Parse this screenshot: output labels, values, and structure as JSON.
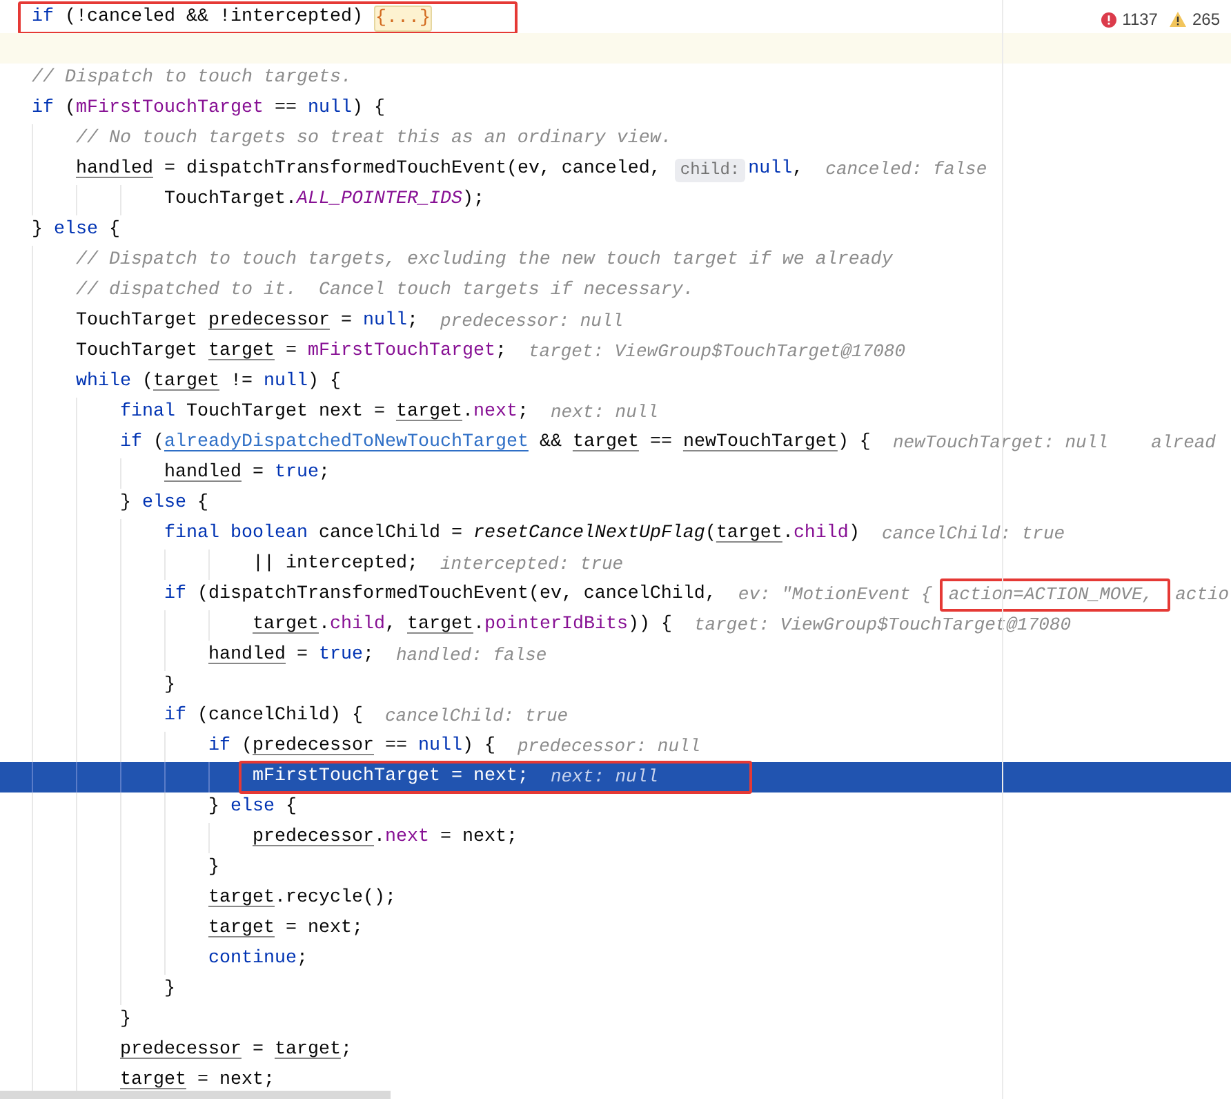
{
  "inspections": {
    "errors": "1137",
    "warnings": "265"
  },
  "lines": [
    {
      "caret_line": false,
      "execution_point": false,
      "segments": [
        {
          "kind": "box",
          "segments": [
            {
              "kind": "keyword",
              "text": "if"
            },
            {
              "kind": "plain",
              "text": " (!canceled && !intercepted) "
            },
            {
              "kind": "fold",
              "text": "{...}"
            }
          ]
        }
      ]
    },
    {
      "caret_line": true,
      "execution_point": false
    },
    {
      "caret_line": false,
      "execution_point": false,
      "segments": [
        {
          "kind": "comment",
          "text": "// Dispatch to touch targets."
        }
      ]
    },
    {
      "caret_line": false,
      "execution_point": false,
      "segments": [
        {
          "kind": "keyword",
          "text": "if"
        },
        {
          "kind": "plain",
          "text": " ("
        },
        {
          "kind": "field",
          "text": "mFirstTouchTarget"
        },
        {
          "kind": "plain",
          "text": " == "
        },
        {
          "kind": "keyword",
          "text": "null"
        },
        {
          "kind": "plain",
          "text": ") {"
        }
      ]
    },
    {
      "caret_line": false,
      "execution_point": false,
      "segments": [
        {
          "kind": "comment",
          "text": "    // No touch targets so treat this as an ordinary view."
        }
      ]
    },
    {
      "caret_line": false,
      "execution_point": false,
      "segments": [
        {
          "kind": "variable",
          "text": "    handled"
        },
        {
          "kind": "plain",
          "text": " = dispatchTransformedTouchEvent(ev, canceled, "
        },
        {
          "kind": "param",
          "text": "child:"
        },
        {
          "kind": "keyword",
          "text": "null"
        },
        {
          "kind": "plain",
          "text": ",  "
        },
        {
          "kind": "hint",
          "text": "canceled: false"
        }
      ]
    },
    {
      "caret_line": false,
      "execution_point": false,
      "segments": [
        {
          "kind": "plain",
          "text": "            TouchTarget."
        },
        {
          "kind": "static",
          "text": "ALL_POINTER_IDS"
        },
        {
          "kind": "plain",
          "text": ");"
        }
      ]
    },
    {
      "caret_line": false,
      "execution_point": false,
      "segments": [
        {
          "kind": "plain",
          "text": "} "
        },
        {
          "kind": "keyword",
          "text": "else"
        },
        {
          "kind": "plain",
          "text": " {"
        }
      ]
    },
    {
      "caret_line": false,
      "execution_point": false,
      "segments": [
        {
          "kind": "comment",
          "text": "    // Dispatch to touch targets, excluding the new touch target if we already"
        }
      ]
    },
    {
      "caret_line": false,
      "execution_point": false,
      "segments": [
        {
          "kind": "comment",
          "text": "    // dispatched to it.  Cancel touch targets if necessary."
        }
      ]
    },
    {
      "caret_line": false,
      "execution_point": false,
      "segments": [
        {
          "kind": "plain",
          "text": "    TouchTarget "
        },
        {
          "kind": "variable",
          "text": "predecessor"
        },
        {
          "kind": "plain",
          "text": " = "
        },
        {
          "kind": "keyword",
          "text": "null"
        },
        {
          "kind": "plain",
          "text": ";  "
        },
        {
          "kind": "hint",
          "text": "predecessor: null"
        }
      ]
    },
    {
      "caret_line": false,
      "execution_point": false,
      "segments": [
        {
          "kind": "plain",
          "text": "    TouchTarget "
        },
        {
          "kind": "variable",
          "text": "target"
        },
        {
          "kind": "plain",
          "text": " = "
        },
        {
          "kind": "field",
          "text": "mFirstTouchTarget"
        },
        {
          "kind": "plain",
          "text": ";  "
        },
        {
          "kind": "hint",
          "text": "target: ViewGroup$TouchTarget@17080"
        }
      ]
    },
    {
      "caret_line": false,
      "execution_point": false,
      "segments": [
        {
          "kind": "keyword",
          "text": "    while"
        },
        {
          "kind": "plain",
          "text": " ("
        },
        {
          "kind": "variable",
          "text": "target"
        },
        {
          "kind": "plain",
          "text": " != "
        },
        {
          "kind": "keyword",
          "text": "null"
        },
        {
          "kind": "plain",
          "text": ") {"
        }
      ]
    },
    {
      "caret_line": false,
      "execution_point": false,
      "segments": [
        {
          "kind": "keyword",
          "text": "        final"
        },
        {
          "kind": "plain",
          "text": " TouchTarget next = "
        },
        {
          "kind": "variable",
          "text": "target"
        },
        {
          "kind": "plain",
          "text": "."
        },
        {
          "kind": "field",
          "text": "next"
        },
        {
          "kind": "plain",
          "text": ";  "
        },
        {
          "kind": "hint",
          "text": "next: null"
        }
      ]
    },
    {
      "caret_line": false,
      "execution_point": false,
      "segments": [
        {
          "kind": "keyword",
          "text": "        if"
        },
        {
          "kind": "plain",
          "text": " ("
        },
        {
          "kind": "reference",
          "text": "alreadyDispatchedToNewTouchTarget"
        },
        {
          "kind": "plain",
          "text": " && "
        },
        {
          "kind": "variable",
          "text": "target"
        },
        {
          "kind": "plain",
          "text": " == "
        },
        {
          "kind": "variable",
          "text": "newTouchTarget"
        },
        {
          "kind": "plain",
          "text": ") {  "
        },
        {
          "kind": "hint",
          "text": "newTouchTarget: null    alread"
        }
      ]
    },
    {
      "caret_line": false,
      "execution_point": false,
      "segments": [
        {
          "kind": "variable",
          "text": "            handled"
        },
        {
          "kind": "plain",
          "text": " = "
        },
        {
          "kind": "keyword",
          "text": "true"
        },
        {
          "kind": "plain",
          "text": ";"
        }
      ]
    },
    {
      "caret_line": false,
      "execution_point": false,
      "segments": [
        {
          "kind": "plain",
          "text": "        } "
        },
        {
          "kind": "keyword",
          "text": "else"
        },
        {
          "kind": "plain",
          "text": " {"
        }
      ]
    },
    {
      "caret_line": false,
      "execution_point": false,
      "segments": [
        {
          "kind": "keyword",
          "text": "            final boolean"
        },
        {
          "kind": "plain",
          "text": " cancelChild = "
        },
        {
          "kind": "method",
          "text": "resetCancelNextUpFlag"
        },
        {
          "kind": "plain",
          "text": "("
        },
        {
          "kind": "variable",
          "text": "target"
        },
        {
          "kind": "plain",
          "text": "."
        },
        {
          "kind": "field",
          "text": "child"
        },
        {
          "kind": "plain",
          "text": ")  "
        },
        {
          "kind": "hint",
          "text": "cancelChild: true"
        }
      ]
    },
    {
      "caret_line": false,
      "execution_point": false,
      "segments": [
        {
          "kind": "plain",
          "text": "                    || intercepted;  "
        },
        {
          "kind": "hint",
          "text": "intercepted: true"
        }
      ]
    },
    {
      "caret_line": false,
      "execution_point": false,
      "segments": [
        {
          "kind": "keyword",
          "text": "            if"
        },
        {
          "kind": "plain",
          "text": " (dispatchTransformedTouchEvent(ev, cancelChild,  "
        },
        {
          "kind": "hint",
          "text": "ev: \"MotionEvent {"
        },
        {
          "kind": "box",
          "segments": [
            {
              "kind": "hint",
              "text": "action=ACTION_MOVE,"
            }
          ]
        },
        {
          "kind": "hint",
          "text": "actio"
        }
      ]
    },
    {
      "caret_line": false,
      "execution_point": false,
      "segments": [
        {
          "kind": "variable",
          "text": "                    target"
        },
        {
          "kind": "plain",
          "text": "."
        },
        {
          "kind": "field",
          "text": "child"
        },
        {
          "kind": "plain",
          "text": ", "
        },
        {
          "kind": "variable",
          "text": "target"
        },
        {
          "kind": "plain",
          "text": "."
        },
        {
          "kind": "field",
          "text": "pointerIdBits"
        },
        {
          "kind": "plain",
          "text": ")) {  "
        },
        {
          "kind": "hint",
          "text": "target: ViewGroup$TouchTarget@17080"
        }
      ]
    },
    {
      "caret_line": false,
      "execution_point": false,
      "segments": [
        {
          "kind": "variable",
          "text": "                handled"
        },
        {
          "kind": "plain",
          "text": " = "
        },
        {
          "kind": "keyword",
          "text": "true"
        },
        {
          "kind": "plain",
          "text": ";  "
        },
        {
          "kind": "hint",
          "text": "handled: false"
        }
      ]
    },
    {
      "caret_line": false,
      "execution_point": false,
      "segments": [
        {
          "kind": "plain",
          "text": "            }"
        }
      ]
    },
    {
      "caret_line": false,
      "execution_point": false,
      "segments": [
        {
          "kind": "keyword",
          "text": "            if"
        },
        {
          "kind": "plain",
          "text": " (cancelChild) {  "
        },
        {
          "kind": "hint",
          "text": "cancelChild: true"
        }
      ]
    },
    {
      "caret_line": false,
      "execution_point": false,
      "segments": [
        {
          "kind": "keyword",
          "text": "                if"
        },
        {
          "kind": "plain",
          "text": " ("
        },
        {
          "kind": "variable",
          "text": "predecessor"
        },
        {
          "kind": "plain",
          "text": " == "
        },
        {
          "kind": "keyword",
          "text": "null"
        },
        {
          "kind": "plain",
          "text": ") {  "
        },
        {
          "kind": "hint",
          "text": "predecessor: null"
        }
      ]
    },
    {
      "caret_line": false,
      "execution_point": true,
      "segments": [
        {
          "kind": "box",
          "segments": [
            {
              "kind": "plain",
              "text": "                    mFirstTouchTarget = next;  "
            },
            {
              "kind": "hint",
              "text": "next: null"
            }
          ]
        }
      ]
    },
    {
      "caret_line": false,
      "execution_point": false,
      "segments": [
        {
          "kind": "plain",
          "text": "                } "
        },
        {
          "kind": "keyword",
          "text": "else"
        },
        {
          "kind": "plain",
          "text": " {"
        }
      ]
    },
    {
      "caret_line": false,
      "execution_point": false,
      "segments": [
        {
          "kind": "variable",
          "text": "                    predecessor"
        },
        {
          "kind": "plain",
          "text": "."
        },
        {
          "kind": "field",
          "text": "next"
        },
        {
          "kind": "plain",
          "text": " = next;"
        }
      ]
    },
    {
      "caret_line": false,
      "execution_point": false,
      "segments": [
        {
          "kind": "plain",
          "text": "                }"
        }
      ]
    },
    {
      "caret_line": false,
      "execution_point": false,
      "segments": [
        {
          "kind": "variable",
          "text": "                target"
        },
        {
          "kind": "plain",
          "text": ".recycle();"
        }
      ]
    },
    {
      "caret_line": false,
      "execution_point": false,
      "segments": [
        {
          "kind": "variable",
          "text": "                target"
        },
        {
          "kind": "plain",
          "text": " = next;"
        }
      ]
    },
    {
      "caret_line": false,
      "execution_point": false,
      "segments": [
        {
          "kind": "keyword",
          "text": "                continue"
        },
        {
          "kind": "plain",
          "text": ";"
        }
      ]
    },
    {
      "caret_line": false,
      "execution_point": false,
      "segments": [
        {
          "kind": "plain",
          "text": "            }"
        }
      ]
    },
    {
      "caret_line": false,
      "execution_point": false,
      "segments": [
        {
          "kind": "plain",
          "text": "        }"
        }
      ]
    },
    {
      "caret_line": false,
      "execution_point": false,
      "segments": [
        {
          "kind": "variable",
          "text": "        predecessor"
        },
        {
          "kind": "plain",
          "text": " = "
        },
        {
          "kind": "variable",
          "text": "target"
        },
        {
          "kind": "plain",
          "text": ";"
        }
      ]
    },
    {
      "caret_line": false,
      "execution_point": false,
      "segments": [
        {
          "kind": "variable",
          "text": "        target"
        },
        {
          "kind": "plain",
          "text": " = next;"
        }
      ]
    }
  ]
}
